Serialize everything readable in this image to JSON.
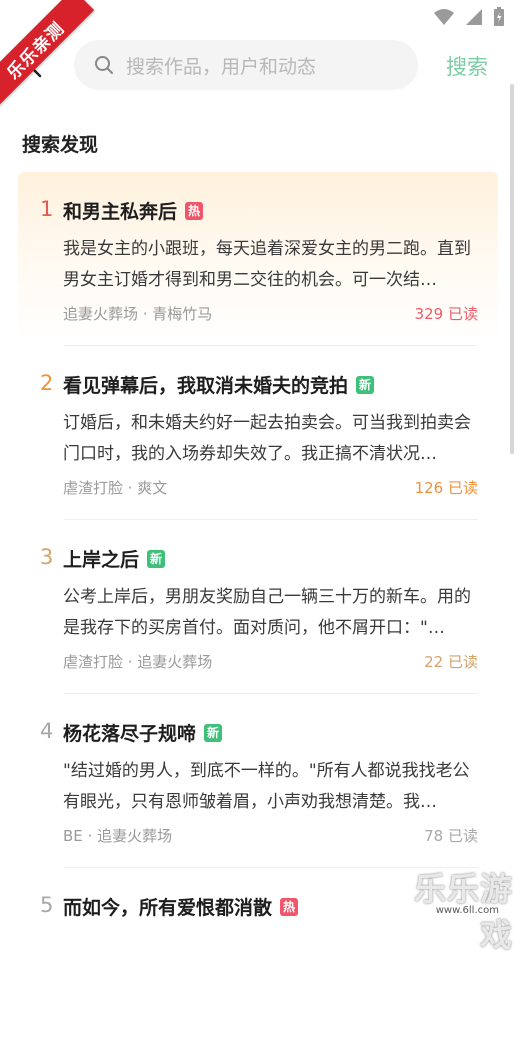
{
  "watermark": {
    "ribbon": "乐乐亲测",
    "brand": "乐乐游戏",
    "url": "www.6ll.com"
  },
  "search": {
    "placeholder": "搜索作品，用户和动态",
    "button_label": "搜索"
  },
  "section_title": "搜索发现",
  "items": [
    {
      "rank": "1",
      "rank_color": "#e8584f",
      "title": "和男主私奔后",
      "tag": "热",
      "tag_color": "#f0556a",
      "description": "我是女主的小跟班，每天追着深爱女主的男二跑。直到男女主订婚才得到和男二交往的机会。可一次结…",
      "meta": "追妻火葬场 · 青梅竹马",
      "reads": "329 已读",
      "reads_color": "#f05a66"
    },
    {
      "rank": "2",
      "rank_color": "#f0923b",
      "title": "看见弹幕后，我取消未婚夫的竞拍",
      "tag": "新",
      "tag_color": "#3fc07a",
      "description": "订婚后，和未婚夫约好一起去拍卖会。可当我到拍卖会门口时，我的入场券却失效了。我正搞不清状况…",
      "meta": "虐渣打脸 · 爽文",
      "reads": "126 已读",
      "reads_color": "#f0923b"
    },
    {
      "rank": "3",
      "rank_color": "#d6a26a",
      "title": "上岸之后",
      "tag": "新",
      "tag_color": "#3fc07a",
      "description": "公考上岸后，男朋友奖励自己一辆三十万的新车。用的是我存下的买房首付。面对质问，他不屑开口：\"…",
      "meta": "虐渣打脸 · 追妻火葬场",
      "reads": "22 已读",
      "reads_color": "#d6a26a"
    },
    {
      "rank": "4",
      "rank_color": "#a8a8a8",
      "title": "杨花落尽子规啼",
      "tag": "新",
      "tag_color": "#3fc07a",
      "description": "\"结过婚的男人，到底不一样的。\"所有人都说我找老公有眼光，只有恩师皱着眉，小声劝我想清楚。我…",
      "meta": "BE · 追妻火葬场",
      "reads": "78 已读",
      "reads_color": "#a8a8a8"
    },
    {
      "rank": "5",
      "rank_color": "#a8a8a8",
      "title": "而如今，所有爱恨都消散",
      "tag": "热",
      "tag_color": "#f0556a",
      "description": "",
      "meta": "",
      "reads": "",
      "reads_color": "#a8a8a8"
    }
  ]
}
